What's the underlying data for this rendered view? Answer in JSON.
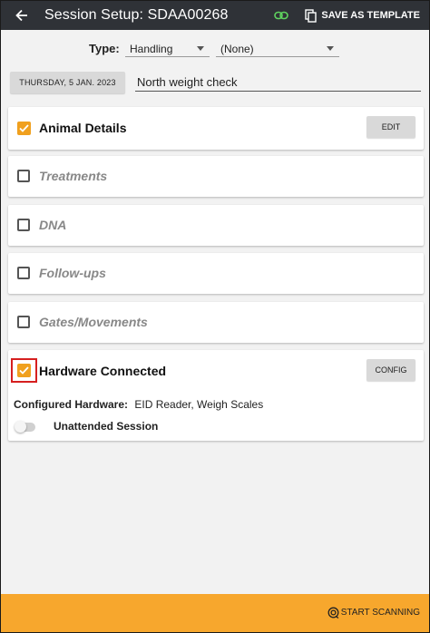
{
  "header": {
    "title": "Session Setup: SDAA00268",
    "save_template_label": "SAVE AS TEMPLATE"
  },
  "type_row": {
    "label": "Type:",
    "type_value": "Handling",
    "group_value": "(None)"
  },
  "session": {
    "date_label": "THURSDAY, 5 JAN. 2023",
    "description": "North weight check"
  },
  "sections": {
    "animal_details": {
      "title": "Animal Details",
      "checked": true,
      "button": "EDIT"
    },
    "treatments": {
      "title": "Treatments",
      "checked": false
    },
    "dna": {
      "title": "DNA",
      "checked": false
    },
    "follow_ups": {
      "title": "Follow-ups",
      "checked": false
    },
    "gates": {
      "title": "Gates/Movements",
      "checked": false
    }
  },
  "hardware": {
    "title": "Hardware Connected",
    "checked": true,
    "button": "CONFIG",
    "configured_label": "Configured Hardware:",
    "configured_value": "EID Reader, Weigh Scales",
    "unattended_label": "Unattended Session",
    "unattended_enabled": false
  },
  "footer": {
    "start_label": "START SCANNING"
  },
  "colors": {
    "appbar": "#2f3237",
    "accent": "#f0a01e",
    "footer": "#f7a72d",
    "link_icon": "#5fd35f",
    "highlight": "#d61f1f"
  },
  "icons": {
    "back": "arrow-left-icon",
    "link": "link-icon",
    "copy": "copy-icon",
    "scan": "scan-icon"
  }
}
